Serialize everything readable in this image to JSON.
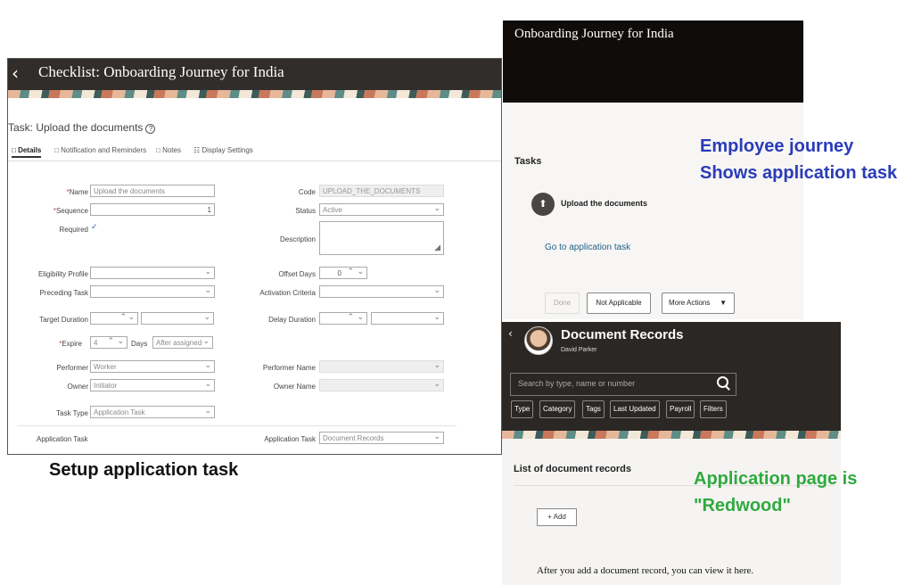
{
  "setup": {
    "title": "Checklist: Onboarding Journey for India",
    "task_label": "Task: Upload the documents",
    "info_glyph": "?",
    "tabs": [
      "Details",
      "Notification and Reminders",
      "Notes",
      "Display Settings"
    ],
    "fields": {
      "name_label": "Name",
      "name_value": "Upload the documents",
      "sequence_label": "Sequence",
      "sequence_value": "1",
      "required_label": "Required",
      "code_label": "Code",
      "code_value": "UPLOAD_THE_DOCUMENTS",
      "status_label": "Status",
      "status_value": "Active",
      "description_label": "Description",
      "eligibility_label": "Eligibility Profile",
      "offset_label": "Offset Days",
      "offset_value": "0",
      "preceding_label": "Preceding Task",
      "activation_label": "Activation Criteria",
      "target_label": "Target Duration",
      "delay_label": "Delay Duration",
      "expire_label": "Expire",
      "expire_value": "4",
      "days_label": "Days",
      "after_value": "After assigned",
      "performer_label": "Performer",
      "performer_value": "Worker",
      "performer_name_label": "Performer Name",
      "owner_label": "Owner",
      "owner_value": "Initiator",
      "owner_name_label": "Owner Name",
      "task_type_label": "Task Type",
      "task_type_value": "Application Task",
      "app_task_section": "Application Task",
      "app_task_label": "Application Task",
      "app_task_value": "Document Records"
    },
    "caption": "Setup application task"
  },
  "journey": {
    "title": "Onboarding Journey for India",
    "tasks_heading": "Tasks",
    "task_name": "Upload the documents",
    "go_link": "Go to application task",
    "buttons": {
      "done": "Done",
      "not_applicable": "Not Applicable",
      "more": "More Actions"
    }
  },
  "notes": {
    "journey_line1": "Employee journey",
    "journey_line2": "Shows application task",
    "redwood_line1": "Application page is",
    "redwood_line2": "\"Redwood\""
  },
  "docs": {
    "title": "Document Records",
    "person": "David Parker",
    "search_placeholder": "Search by type, name or number",
    "chips": [
      "Type",
      "Category",
      "Tags",
      "Last Updated",
      "Payroll",
      "Filters"
    ],
    "list_heading": "List of document records",
    "add_label": "Add",
    "empty_text": "After you add a document record, you can view it here."
  },
  "colors": {
    "header_dark": "#312d2a",
    "journey_header": "#100c0a",
    "link": "#22638a",
    "note_blue": "#2a3cb8",
    "note_green": "#2faa3f"
  }
}
